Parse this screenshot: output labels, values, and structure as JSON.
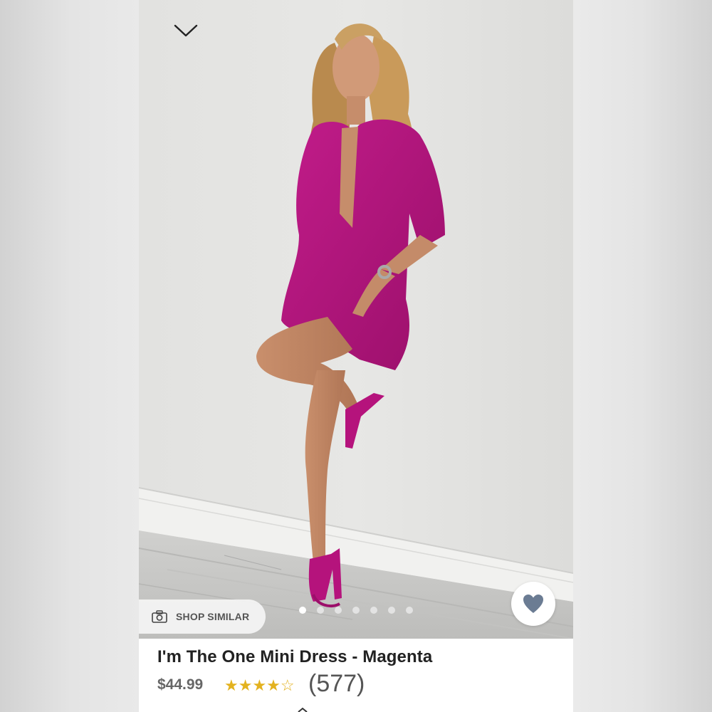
{
  "header": {
    "collapse_icon": "chevron-down-icon"
  },
  "photo": {
    "description_icon": "product-photo",
    "dress_color": "#b5147e",
    "wall_color": "#e3e3e1",
    "floor_color": "#cfcfcd",
    "carousel": {
      "total": 7,
      "active_index": 0
    }
  },
  "shop_similar": {
    "icon": "camera-icon",
    "label": "SHOP SIMILAR"
  },
  "favorite": {
    "icon": "heart-icon",
    "icon_color": "#6b7c93"
  },
  "product": {
    "title": "I'm The One Mini Dress - Magenta",
    "price": "$44.99",
    "rating": 4.5,
    "stars": "★★★★☆",
    "review_count": "(577)"
  },
  "colors": {
    "star": "#e3b21f"
  }
}
